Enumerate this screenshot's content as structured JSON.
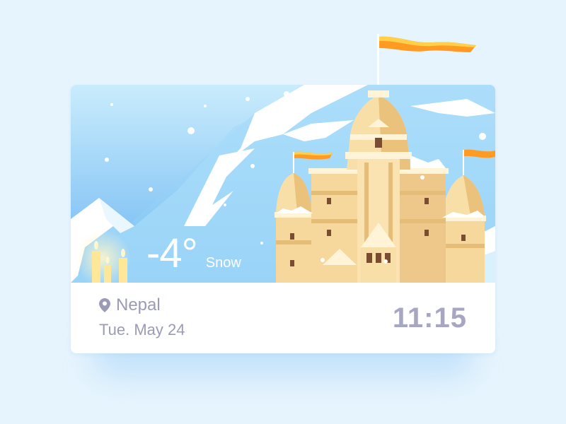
{
  "weather": {
    "temperature": "-4°",
    "condition": "Snow"
  },
  "location": {
    "name": "Nepal",
    "icon": "map-pin-icon"
  },
  "date": "Tue. May 24",
  "time": "11:15",
  "colors": {
    "background": "#e6f4fd",
    "sky_top": "#bfe6fb",
    "sky_bottom": "#6fb9f3",
    "temple": "#f6d79c",
    "flag": "#ff8a1e",
    "text_muted": "#9b9bb8",
    "time_text": "#a7a7c4"
  }
}
